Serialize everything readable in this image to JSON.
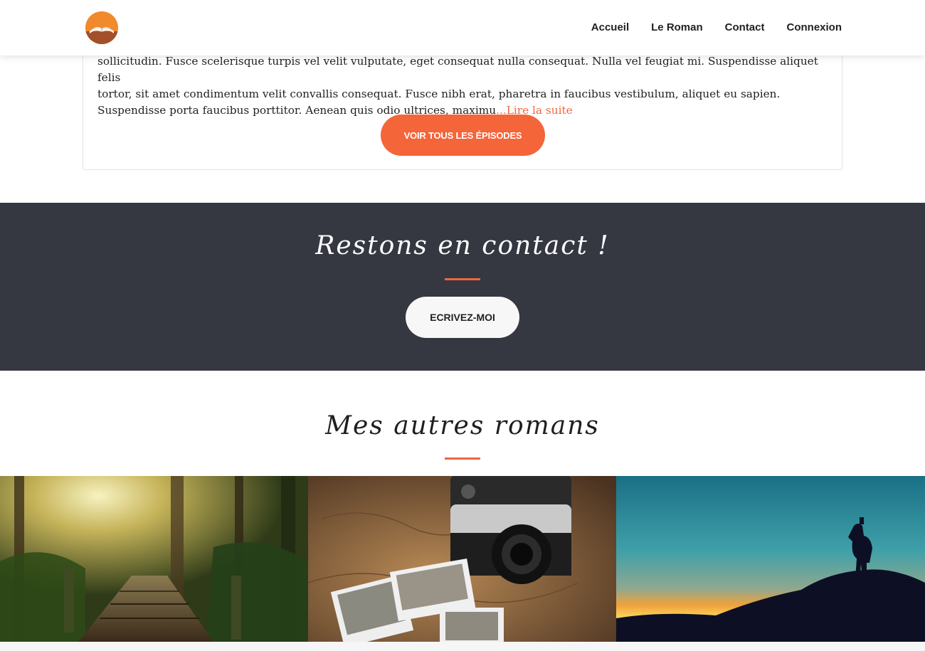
{
  "header": {
    "logo_icon": "open-book-sunset-icon",
    "nav": [
      {
        "label": "Accueil"
      },
      {
        "label": "Le Roman"
      },
      {
        "label": "Contact"
      },
      {
        "label": "Connexion"
      }
    ]
  },
  "episode_card": {
    "excerpt_line1": "sollicitudin. Fusce scelerisque turpis vel velit vulputate, eget consequat nulla consequat. Nulla vel feugiat mi. Suspendisse aliquet felis",
    "excerpt_line2": "tortor, sit amet condimentum velit convallis consequat. Fusce nibh erat, pharetra in faucibus vestibulum, aliquet eu sapien.",
    "excerpt_line3": "Suspendisse porta faucibus porttitor. Aenean quis odio ultrices, maximu",
    "read_more": "...Lire la suite",
    "button": "VOIR TOUS LES ÉPISODES"
  },
  "contact": {
    "title": "Restons en contact !",
    "button": "ECRIVEZ-MOI"
  },
  "novels": {
    "title": "Mes autres romans",
    "images": [
      {
        "icon": "forest-boardwalk-image"
      },
      {
        "icon": "vintage-camera-photos-image"
      },
      {
        "icon": "hiker-silhouette-sunset-image"
      }
    ]
  },
  "colors": {
    "accent": "#f4653a",
    "dark_band": "#353841",
    "logo": "#f08a2c"
  }
}
